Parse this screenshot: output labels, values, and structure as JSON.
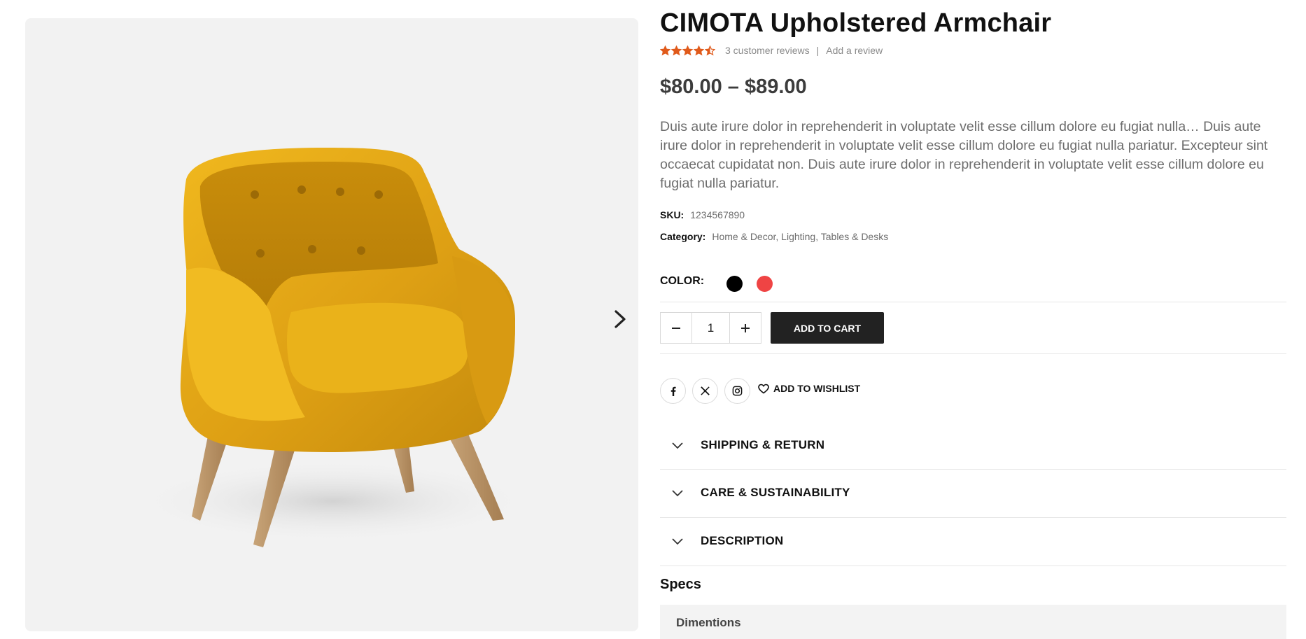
{
  "product": {
    "title": "CIMOTA Upholstered Armchair",
    "rating": 4.5,
    "rating_max": 5,
    "reviews_text": "3 customer reviews",
    "separator": "|",
    "add_review": "Add a review",
    "price": "$80.00 – $89.00",
    "description": "Duis aute irure dolor in reprehenderit in voluptate velit esse cillum dolore eu fugiat nulla… Duis aute irure dolor in reprehenderit in voluptate velit esse cillum dolore eu fugiat nulla pariatur. Excepteur sint occaecat cupidatat non. Duis aute irure dolor in reprehenderit in voluptate velit esse cillum dolore eu fugiat nulla pariatur.",
    "sku_label": "SKU:",
    "sku_value": "1234567890",
    "category_label": "Category:",
    "category_value": "Home & Decor, Lighting, Tables & Desks"
  },
  "color": {
    "label": "COLOR:",
    "options": [
      {
        "name": "black",
        "hex": "#000000"
      },
      {
        "name": "red",
        "hex": "#ef4444"
      }
    ]
  },
  "cart": {
    "quantity": "1",
    "minus_icon": "minus-icon",
    "plus_icon": "plus-icon",
    "add_to_cart": "ADD TO CART"
  },
  "share": {
    "icons": [
      "facebook-icon",
      "x-twitter-icon",
      "instagram-icon"
    ],
    "wishlist": "ADD TO WISHLIST"
  },
  "accordions": [
    {
      "label": "SHIPPING & RETURN"
    },
    {
      "label": "CARE & SUSTAINABILITY"
    },
    {
      "label": "DESCRIPTION"
    }
  ],
  "specs": {
    "heading": "Specs",
    "first_row": "Dimentions"
  },
  "colors": {
    "star": "#e05a1b",
    "button_bg": "#222222",
    "gallery_bg": "#f2f2f2",
    "chair": "#e3a514"
  },
  "gallery": {
    "next_icon": "chevron-right-icon",
    "image_icon": "armchair-image"
  }
}
